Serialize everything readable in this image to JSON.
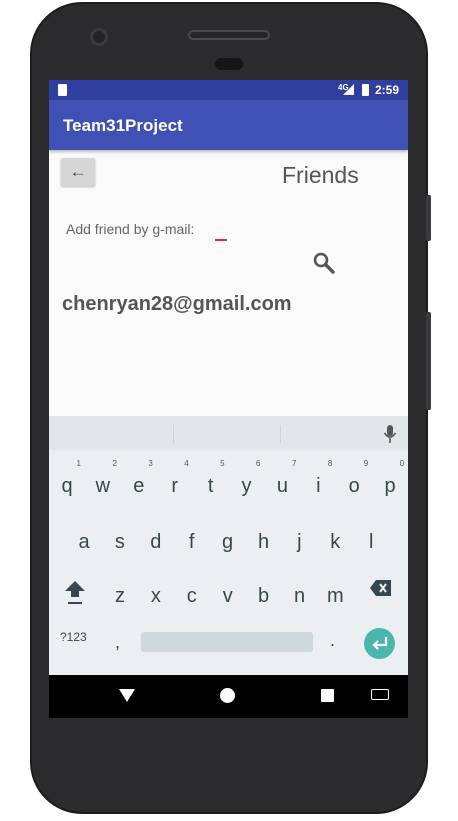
{
  "status_bar": {
    "network": "4G",
    "time": "2:59"
  },
  "app_bar": {
    "title": "Team31Project"
  },
  "screen": {
    "back_glyph": "←",
    "title": "Friends",
    "add_label": "Add friend by g-mail:",
    "input_value": "",
    "search_icon": "search-icon",
    "email": "chenryan28@gmail.com"
  },
  "keyboard": {
    "row1": [
      "q",
      "w",
      "e",
      "r",
      "t",
      "y",
      "u",
      "i",
      "o",
      "p"
    ],
    "row1_hints": [
      "1",
      "2",
      "3",
      "4",
      "5",
      "6",
      "7",
      "8",
      "9",
      "0"
    ],
    "row2": [
      "a",
      "s",
      "d",
      "f",
      "g",
      "h",
      "j",
      "k",
      "l"
    ],
    "row3": [
      "z",
      "x",
      "c",
      "v",
      "b",
      "n",
      "m"
    ],
    "symbols_label": "?123",
    "comma": ",",
    "period": ".",
    "enter_color": "#4db6ac"
  },
  "colors": {
    "app_bar": "#3f51b5",
    "status_bar": "#303f9f",
    "accent": "#e91e63"
  }
}
